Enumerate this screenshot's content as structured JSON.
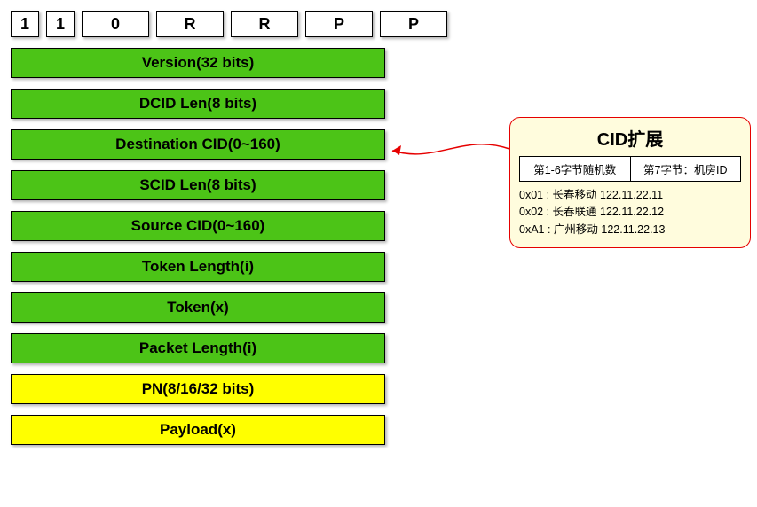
{
  "bits": {
    "b0": "1",
    "b1": "1",
    "b2": "0",
    "b3": "R",
    "b4": "R",
    "b5": "P",
    "b6": "P"
  },
  "fields": {
    "version": "Version(32 bits)",
    "dcid_len": "DCID Len(8 bits)",
    "dcid": "Destination CID(0~160)",
    "scid_len": "SCID Len(8 bits)",
    "scid": "Source CID(0~160)",
    "token_len": "Token Length(i)",
    "token": "Token(x)",
    "pkt_len": "Packet Length(i)",
    "pn": "PN(8/16/32 bits)",
    "payload": "Payload(x)"
  },
  "callout": {
    "title": "CID扩展",
    "col1": "第1-6字节随机数",
    "col2": "第7字节：机房ID",
    "line1": "0x01 : 长春移动 122.11.22.11",
    "line2": "0x02 : 长春联通 122.11.22.12",
    "line3": "0xA1 : 广州移动 122.11.22.13"
  },
  "colors": {
    "green": "#4CC417",
    "yellow": "#FFFF00",
    "callout_border": "#e60000",
    "callout_bg": "#FFFCDD"
  }
}
